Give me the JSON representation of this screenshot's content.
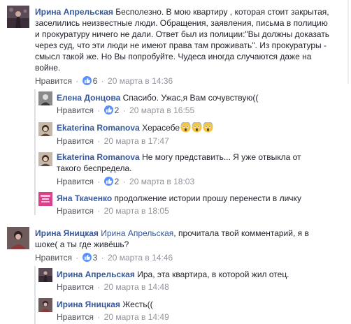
{
  "comments": {
    "c1": {
      "author": "Ирина Апрельская",
      "lines": [
        "Бесполезно. В мою квартиру , которая стоит закрытая,",
        "заселились неизвестные люди. Обращения, заявления, письма в полицию",
        "и прокуратуру ничего не дали. Ответ был из полиции:\"Вы должны доказать",
        "через суд, что эти люди не имеют права там проживать\". Из прокуратуры -",
        "смысл такой же. Но Вы попробуйте. Чудеса иногда случаются даже на",
        "войне."
      ],
      "like_label": "Нравится",
      "likes": "6",
      "time": "20 марта в 14:36"
    },
    "r1": {
      "author": "Елена Донцова",
      "text": "Спасибо. Ужас,я Вам сочувствую((",
      "like_label": "Нравится",
      "likes": "2",
      "time": "20 марта в 16:55"
    },
    "r2": {
      "author": "Ekaterina Romanova",
      "text": "Херасебе",
      "emoji": [
        "scream-emoji",
        "scream-emoji",
        "scream-emoji"
      ],
      "like_label": "Нравится",
      "time": "20 марта в 17:47"
    },
    "r3": {
      "author": "Ekaterina Romanova",
      "lines": [
        "Не могу представить... Я уже отвыкла от",
        "такого беспредела."
      ],
      "like_label": "Нравится",
      "likes": "2",
      "time": "20 марта в 18:03"
    },
    "r4": {
      "author": "Яна Ткаченко",
      "text": "продолжение истории прошу перенести в личку",
      "like_label": "Нравится",
      "time": "20 марта в 18:05"
    },
    "c2": {
      "author": "Ирина Яницкая",
      "mention": "Ирина Апрельская",
      "text_after": ", прочитала твой комментарий, я в",
      "line2": "шоке( а ты где живёшь?",
      "like_label": "Нравится",
      "likes": "3",
      "time": "20 марта в 14:46"
    },
    "r5": {
      "author": "Ирина Апрельская",
      "text": "Ира, эта квартира, в которой жил отец.",
      "like_label": "Нравится",
      "time": "20 марта в 14:48"
    },
    "r6": {
      "author": "Ирина Яницкая",
      "text": "Жесть((",
      "like_label": "Нравится",
      "time": "20 марта в 14:49"
    }
  },
  "colors": {
    "author": "#365899",
    "text": "#1d2129",
    "meta": "#90949c",
    "like_badge": "#5890ff"
  }
}
